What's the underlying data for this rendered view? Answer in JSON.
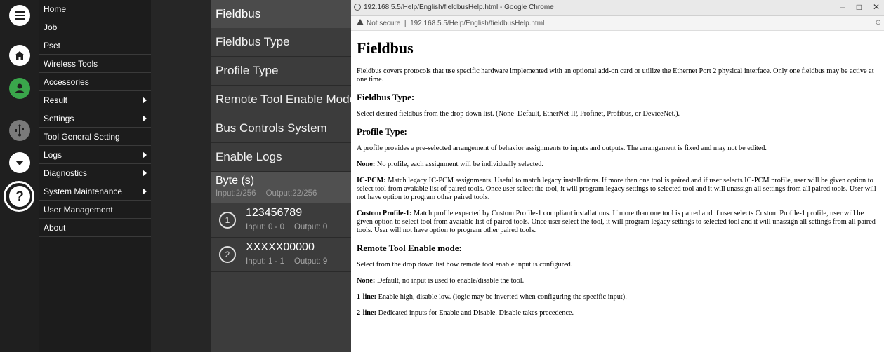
{
  "menu": {
    "items": [
      {
        "label": "Home",
        "has_submenu": false
      },
      {
        "label": "Job",
        "has_submenu": false
      },
      {
        "label": "Pset",
        "has_submenu": false
      },
      {
        "label": "Wireless Tools",
        "has_submenu": false
      },
      {
        "label": "Accessories",
        "has_submenu": false
      },
      {
        "label": "Result",
        "has_submenu": true
      },
      {
        "label": "Settings",
        "has_submenu": true
      },
      {
        "label": "Tool General Setting",
        "has_submenu": false
      },
      {
        "label": "Logs",
        "has_submenu": true
      },
      {
        "label": "Diagnostics",
        "has_submenu": true
      },
      {
        "label": "System Maintenance",
        "has_submenu": true
      },
      {
        "label": "User Management",
        "has_submenu": false
      },
      {
        "label": "About",
        "has_submenu": false
      }
    ]
  },
  "rail": {
    "icons": [
      "menu-icon",
      "home-icon",
      "user-icon",
      "usb-icon",
      "dropdown-icon",
      "help-icon"
    ],
    "colors": {
      "active_user": "#3aa64b",
      "icon_white": "#ffffff",
      "icon_muted": "#7a7a7a"
    }
  },
  "fieldbus": {
    "header": "Fieldbus",
    "rows": [
      "Fieldbus Type",
      "Profile Type",
      "Remote Tool Enable Mode",
      "Bus Controls System",
      "Enable Logs"
    ],
    "byte": {
      "title": "Byte (s)",
      "input": "Input:2/256",
      "output": "Output:22/256",
      "entries": [
        {
          "num": "1",
          "name": "123456789",
          "input": "Input: 0 - 0",
          "output": "Output: 0"
        },
        {
          "num": "2",
          "name": "XXXXX00000",
          "input": "Input: 1 - 1",
          "output": "Output: 9"
        }
      ]
    }
  },
  "browser": {
    "window_title": "192.168.5.5/Help/English/fieldbusHelp.html - Google Chrome",
    "not_secure": "Not secure",
    "url": "192.168.5.5/Help/English/fieldbusHelp.html",
    "controls": {
      "minimize": "–",
      "maximize": "□",
      "close": "✕"
    }
  },
  "doc": {
    "title": "Fieldbus",
    "intro": "Fieldbus covers protocols that use specific hardware implemented with an optional add-on card or utilize the Ethernet Port 2 physical interface. Only one fieldbus may be active at one time.",
    "fieldbus_type_heading": "Fieldbus Type:",
    "fieldbus_type_text": "Select desired fieldbus from the drop down list. (None–Default, EtherNet IP, Profinet, Profibus, or DeviceNet.).",
    "profile_type_heading": "Profile Type:",
    "profile_type_text": "A profile provides a pre-selected arrangement of behavior assignments to inputs and outputs. The arrangement is fixed and may not be edited.",
    "none_label": "None:",
    "none_text": " No profile, each assignment will be individually selected.",
    "icpcm_label": "IC-PCM:",
    "icpcm_text": " Match legacy IC-PCM assignments. Useful to match legacy installations. If more than one tool is paired and if user selects IC-PCM profile, user will be given option to select tool from avaiable list of paired tools. Once user select the tool, it will program legacy settings to selected tool and it will unassign all settings from all paired tools. User will not have option to program other paired tools.",
    "custom_label": "Custom Profile-1:",
    "custom_text": " Match profile expected by Custom Profile-1 compliant installations. If more than one tool is paired and if user selects Custom Profile-1 profile, user will be given option to select tool from avaiable list of paired tools. Once user select the tool, it will program legacy settings to selected tool and it will unassign all settings from all paired tools. User will not have option to program other paired tools.",
    "remote_heading": "Remote Tool Enable mode:",
    "remote_text": "Select from the drop down list how remote tool enable input is configured.",
    "none2_label": "None:",
    "none2_text": " Default, no input is used to enable/disable the tool.",
    "oneline_label": "1-line:",
    "oneline_text": " Enable high, disable low. (logic may be inverted when configuring the specific input).",
    "twoline_label": "2-line:",
    "twoline_text": " Dedicated inputs for Enable and Disable. Disable takes precedence."
  }
}
